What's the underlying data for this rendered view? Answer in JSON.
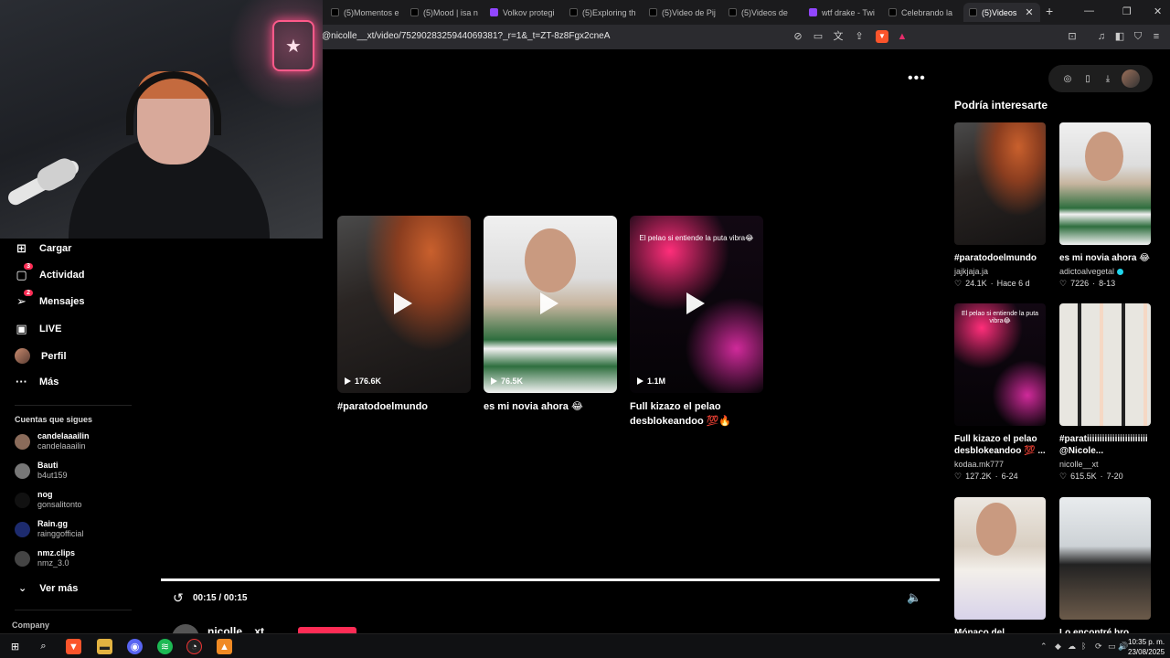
{
  "browser": {
    "tabs": [
      {
        "label": "(5)Momentos e",
        "icon": "tiktok"
      },
      {
        "label": "(5)Mood | isa n",
        "icon": "tiktok"
      },
      {
        "label": "Volkov protegi",
        "icon": "twitch"
      },
      {
        "label": "(5)Exploring th",
        "icon": "tiktok"
      },
      {
        "label": "(5)Video de Pij",
        "icon": "tiktok"
      },
      {
        "label": "(5)Videos de",
        "icon": "tiktok"
      },
      {
        "label": "wtf drake - Twi",
        "icon": "twitch"
      },
      {
        "label": "Celebrando la",
        "icon": "tiktok"
      },
      {
        "label": "(5)Videos",
        "icon": "tiktok",
        "active": true
      }
    ],
    "new_tab": "+",
    "url": "@nicolle__xt/video/7529028325944069381?_r=1&_t=ZT-8z8Fgx2cneA"
  },
  "leftnav": {
    "items": [
      {
        "label": "Cargar",
        "icon": "plus-square-icon"
      },
      {
        "label": "Actividad",
        "icon": "inbox-icon",
        "badge": "3"
      },
      {
        "label": "Mensajes",
        "icon": "send-icon",
        "badge": "2"
      },
      {
        "label": "LIVE",
        "icon": "live-icon"
      },
      {
        "label": "Perfil",
        "icon": "avatar"
      },
      {
        "label": "Más",
        "icon": "ellipsis-icon"
      }
    ],
    "following_title": "Cuentas que sigues",
    "following": [
      {
        "name": "candelaaailin",
        "handle": "candelaaailin",
        "color": "#8a6b5a"
      },
      {
        "name": "Bauti",
        "handle": "b4ut159",
        "color": "#777777"
      },
      {
        "name": "nog",
        "handle": "gonsalitonto",
        "color": "#111111"
      },
      {
        "name": "Rain.gg",
        "handle": "rainggofficial",
        "color": "#1d2b6e"
      },
      {
        "name": "nmz.clips",
        "handle": "nmz_3.0",
        "color": "#444444"
      }
    ],
    "see_more": "Ver más",
    "company": "Company"
  },
  "main": {
    "more_menu": "•••",
    "videos": [
      {
        "views": "176.6K",
        "title": "#paratodoelmundo",
        "thumb": "girl",
        "overlay": ""
      },
      {
        "views": "76.5K",
        "title": "es mi novia ahora 😂",
        "thumb": "guy",
        "overlay": ""
      },
      {
        "views": "1.1M",
        "title": "Full kizazo el pelao desblokeandoo 💯🔥@Pel...",
        "thumb": "party",
        "overlay": "El pelao si entiende la puta vibra😂"
      }
    ],
    "time": "00:15 / 00:15",
    "progress": 1.0,
    "author": "nicolle__xt"
  },
  "right": {
    "title": "Podría interesarte",
    "cards": [
      {
        "title": "#paratodoelmundo",
        "author": "jajkjaja.ja",
        "verified": false,
        "likes": "24.1K",
        "date": "Hace 6 d",
        "thumb": "girl",
        "overlay": ""
      },
      {
        "title": "es mi novia ahora 😂",
        "author": "adictoalvegetal",
        "verified": true,
        "likes": "7226",
        "date": "8-13",
        "thumb": "guy",
        "overlay": ""
      },
      {
        "title": "Full kizazo el pelao desblokeandoo 💯 ...",
        "author": "kodaa.mk777",
        "verified": false,
        "likes": "127.2K",
        "date": "6-24",
        "thumb": "party",
        "overlay": "El pelao si entiende la puta vibra😂"
      },
      {
        "title": "#paratiiiiiiiiiiiiiiiiiiiiiiii @Nicole...",
        "author": "nicolle__xt",
        "verified": false,
        "likes": "615.5K",
        "date": "7-20",
        "thumb": "women",
        "overlay": ""
      },
      {
        "title": "Mónaco del",
        "author": "",
        "verified": false,
        "likes": "",
        "date": "",
        "thumb": "lecture",
        "overlay": ""
      },
      {
        "title": "Lo encontré bro",
        "author": "",
        "verified": false,
        "likes": "",
        "date": "",
        "thumb": "walk",
        "overlay": ""
      }
    ]
  },
  "taskbar": {
    "clock_time": "10:35 p. m.",
    "clock_date": "23/08/2025"
  },
  "colors": {
    "accent": "#fe2c55",
    "background": "#000000",
    "verified": "#20d5ec"
  }
}
